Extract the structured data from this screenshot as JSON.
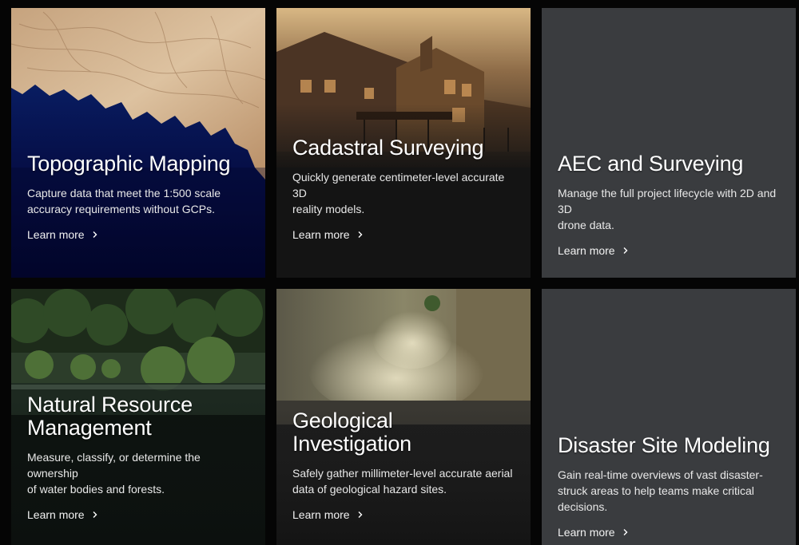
{
  "cards": [
    {
      "title": "Topographic Mapping",
      "description": "Capture data that meet the 1:500 scale\naccuracy requirements without GCPs.",
      "link": "Learn more"
    },
    {
      "title": "Cadastral Surveying",
      "description": "Quickly generate centimeter-level accurate 3D\nreality models.",
      "link": "Learn more"
    },
    {
      "title": "AEC and Surveying",
      "description": "Manage the full project lifecycle with 2D and 3D\ndrone data.",
      "link": "Learn more"
    },
    {
      "title": "Natural Resource\nManagement",
      "description": "Measure, classify, or determine the ownership\nof water bodies and forests.",
      "link": "Learn more"
    },
    {
      "title": "Geological\nInvestigation",
      "description": "Safely gather millimeter-level accurate aerial\ndata of geological hazard sites.",
      "link": "Learn more"
    },
    {
      "title": "Disaster Site Modeling",
      "description": "Gain real-time overviews of vast disaster-\nstruck areas to help teams make critical\ndecisions.",
      "link": "Learn more"
    }
  ],
  "icons": {
    "link_arrow": "chevron-right-icon"
  },
  "colors": {
    "flat_card": "#3a3c3f",
    "page_background": "#050505"
  }
}
